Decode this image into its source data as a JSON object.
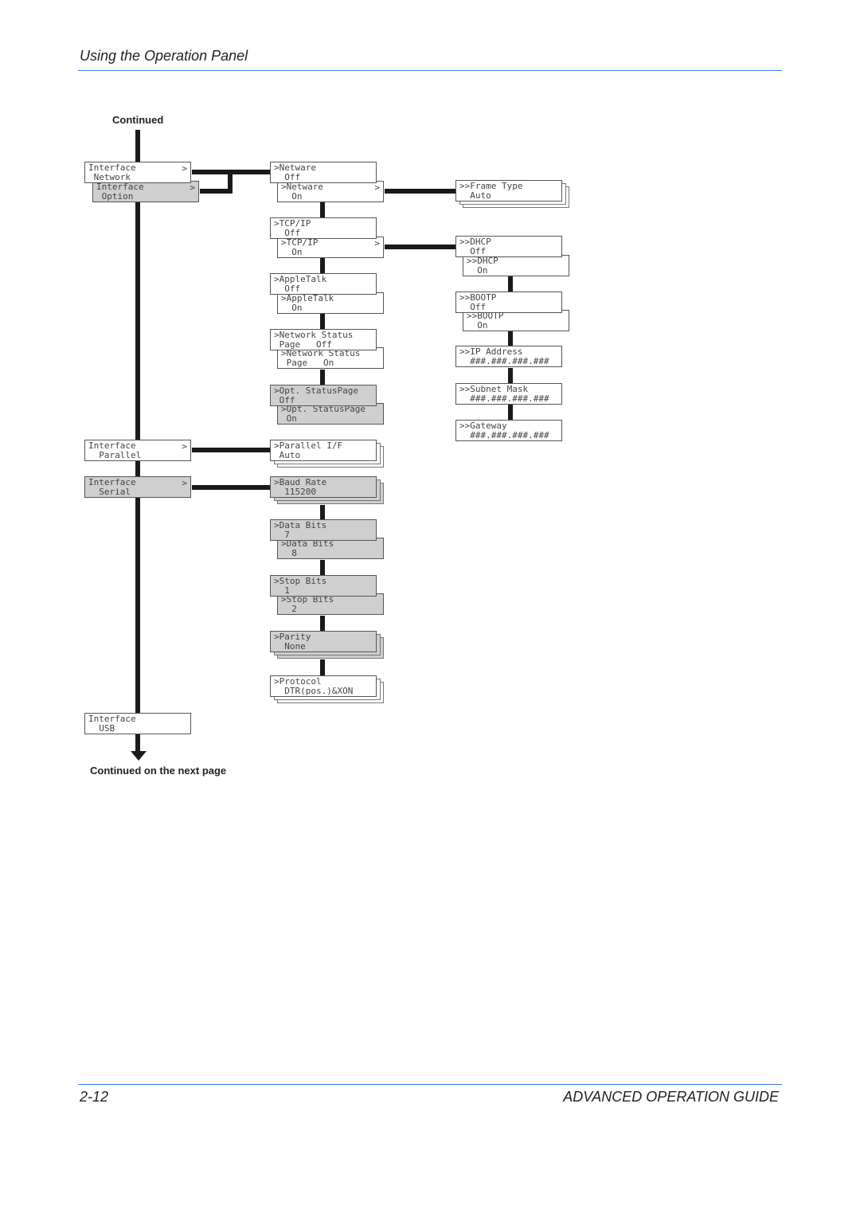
{
  "header": {
    "title": "Using the Operation Panel"
  },
  "notes": {
    "continued": "Continued",
    "continued_next": "Continued on the next page"
  },
  "footer": {
    "page": "2-12",
    "guide": "ADVANCED OPERATION GUIDE"
  },
  "boxes": [
    {
      "l1": "Interface",
      "l2": " Network",
      "arrow": ">"
    },
    {
      "l1": "Interface",
      "l2": " Option",
      "arrow": ">"
    },
    {
      "l1": "Interface",
      "l2": "  Parallel",
      "arrow": ">"
    },
    {
      "l1": "Interface",
      "l2": "  Serial",
      "arrow": ">"
    },
    {
      "l1": "Interface",
      "l2": "  USB",
      "arrow": ""
    },
    {
      "l1": ">Netware",
      "l2": "  Off",
      "arrow": ""
    },
    {
      "l1": ">Netware",
      "l2": "  On",
      "arrow": ">"
    },
    {
      "l1": ">TCP/IP",
      "l2": "  Off",
      "arrow": ""
    },
    {
      "l1": ">TCP/IP",
      "l2": "  On",
      "arrow": ">"
    },
    {
      "l1": ">AppleTalk",
      "l2": "  Off",
      "arrow": ""
    },
    {
      "l1": ">AppleTalk",
      "l2": "  On",
      "arrow": ""
    },
    {
      "l1": ">Network Status",
      "l2": " Page   Off",
      "arrow": ""
    },
    {
      "l1": ">Network Status",
      "l2": " Page   On",
      "arrow": ""
    },
    {
      "l1": ">Opt. StatusPage",
      "l2": " Off",
      "arrow": ""
    },
    {
      "l1": ">Opt. StatusPage",
      "l2": " On",
      "arrow": ""
    },
    {
      "l1": ">Parallel I/F",
      "l2": " Auto",
      "arrow": ""
    },
    {
      "l1": ">Baud Rate",
      "l2": "  115200",
      "arrow": ""
    },
    {
      "l1": ">Data Bits",
      "l2": "  7",
      "arrow": ""
    },
    {
      "l1": ">Data Bits",
      "l2": "  8",
      "arrow": ""
    },
    {
      "l1": ">Stop Bits",
      "l2": "  1",
      "arrow": ""
    },
    {
      "l1": ">Stop Bits",
      "l2": "  2",
      "arrow": ""
    },
    {
      "l1": ">Parity",
      "l2": "  None",
      "arrow": ""
    },
    {
      "l1": ">Protocol",
      "l2": "  DTR(pos.)&XON",
      "arrow": ""
    },
    {
      "l1": ">>Frame Type",
      "l2": "  Auto",
      "arrow": ""
    },
    {
      "l1": ">>DHCP",
      "l2": "  Off",
      "arrow": ""
    },
    {
      "l1": ">>DHCP",
      "l2": "  On",
      "arrow": ""
    },
    {
      "l1": ">>BOOTP",
      "l2": "  Off",
      "arrow": ""
    },
    {
      "l1": ">>BOOTP",
      "l2": "  On",
      "arrow": ""
    },
    {
      "l1": ">>IP Address",
      "l2": "  ###.###.###.###",
      "arrow": ""
    },
    {
      "l1": ">>Subnet Mask",
      "l2": "  ###.###.###.###",
      "arrow": ""
    },
    {
      "l1": ">>Gateway",
      "l2": "  ###.###.###.###",
      "arrow": ""
    }
  ]
}
